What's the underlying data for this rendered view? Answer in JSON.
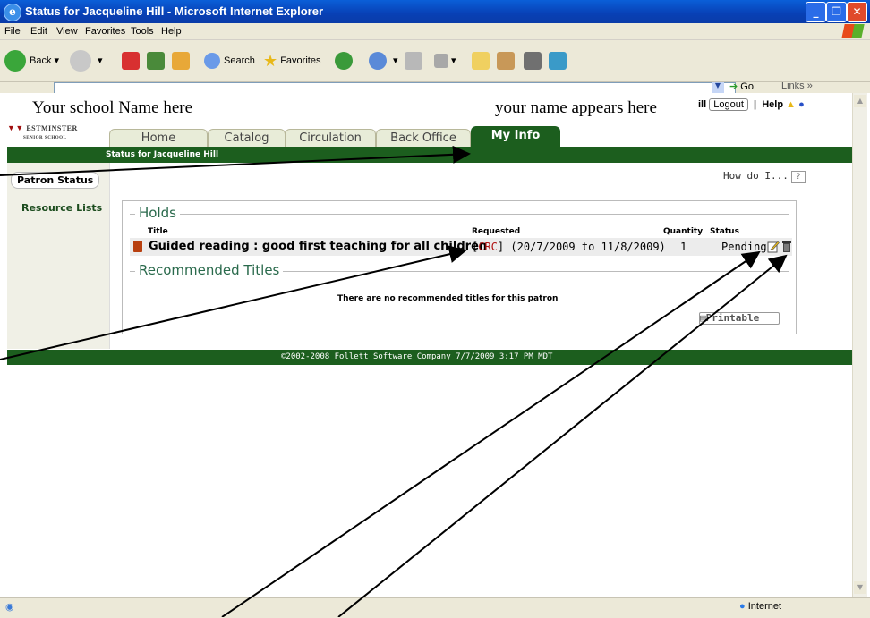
{
  "window": {
    "title": "Status for Jacqueline Hill - Microsoft Internet Explorer"
  },
  "menu": [
    "File",
    "Edit",
    "View",
    "Favorites",
    "Tools",
    "Help"
  ],
  "toolbar": {
    "back": "Back",
    "search": "Search",
    "favorites": "Favorites"
  },
  "address": {
    "go": "Go",
    "links": "Links"
  },
  "header": {
    "school": "Your school Name here",
    "your_name": "your name appears here",
    "logo": "ESTMINSTER",
    "logo_sub": "SENIOR SCHOOL",
    "name_fragment": "ill",
    "logout": "Logout",
    "sep": "|",
    "help": "Help"
  },
  "tabs": [
    {
      "label": "Home"
    },
    {
      "label": "Catalog"
    },
    {
      "label": "Circulation"
    },
    {
      "label": "Back Office"
    },
    {
      "label": "My Info"
    }
  ],
  "greenbar": "Status for Jacqueline Hill",
  "sidebar": [
    {
      "label": "Patron Status"
    },
    {
      "label": "Resource Lists"
    }
  ],
  "howdo": "How do I...",
  "howdo_q": "?",
  "holds": {
    "legend": "Holds",
    "columns": {
      "title": "Title",
      "requested": "Requested",
      "quantity": "Quantity",
      "status": "Status"
    },
    "row": {
      "title": "Guided reading : good first teaching for all children",
      "bracket_open": "[",
      "crc": "CRC",
      "dates": "] (20/7/2009 to 11/8/2009)",
      "quantity": "1",
      "status": "Pending"
    }
  },
  "recommended": {
    "legend": "Recommended Titles",
    "empty": "There are no recommended titles for this patron",
    "printable": "Printable"
  },
  "footer": "©2002-2008 Follett Software Company   7/7/2009 3:17 PM MDT",
  "statusbar": {
    "zone": "Internet"
  },
  "colors": {
    "green": "#1c5e1e",
    "accent_red": "#b01010"
  }
}
